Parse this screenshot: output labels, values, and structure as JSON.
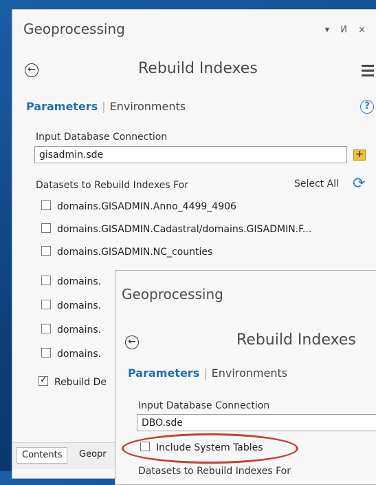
{
  "back_pane": {
    "title": "Geoprocessing",
    "window_controls": "▾ И ×",
    "tool_title": "Rebuild Indexes",
    "tabs": {
      "active": "Parameters",
      "inactive": "Environments"
    },
    "help_glyph": "?",
    "input_label": "Input Database Connection",
    "input_value": "gisadmin.sde",
    "datasets_label": "Datasets to Rebuild Indexes For",
    "select_all": "Select All",
    "datasets": [
      "domains.GISADMIN.Anno_4499_4906",
      "domains.GISADMIN.Cadastral/domains.GISADMIN.F...",
      "domains.GISADMIN.NC_counties",
      "domains.",
      "domains.",
      "domains.",
      "domains."
    ],
    "rebuild_option_partial": "Rebuild De",
    "bottom_tabs": [
      "Contents",
      "Geopr"
    ]
  },
  "front_pane": {
    "title": "Geoprocessing",
    "tool_title": "Rebuild Indexes",
    "tabs": {
      "active": "Parameters",
      "inactive": "Environments"
    },
    "input_label": "Input Database Connection",
    "input_value": "DBO.sde",
    "include_system_tables": "Include System Tables",
    "datasets_label_partial": "Datasets to Rebuild Indexes For"
  },
  "colors": {
    "accent": "#1f6fb5",
    "highlight": "#c0432f",
    "background": "#0e3f7c"
  },
  "icons": [
    "back-arrow-icon",
    "hamburger-menu-icon",
    "help-icon",
    "add-connection-icon",
    "refresh-icon"
  ]
}
